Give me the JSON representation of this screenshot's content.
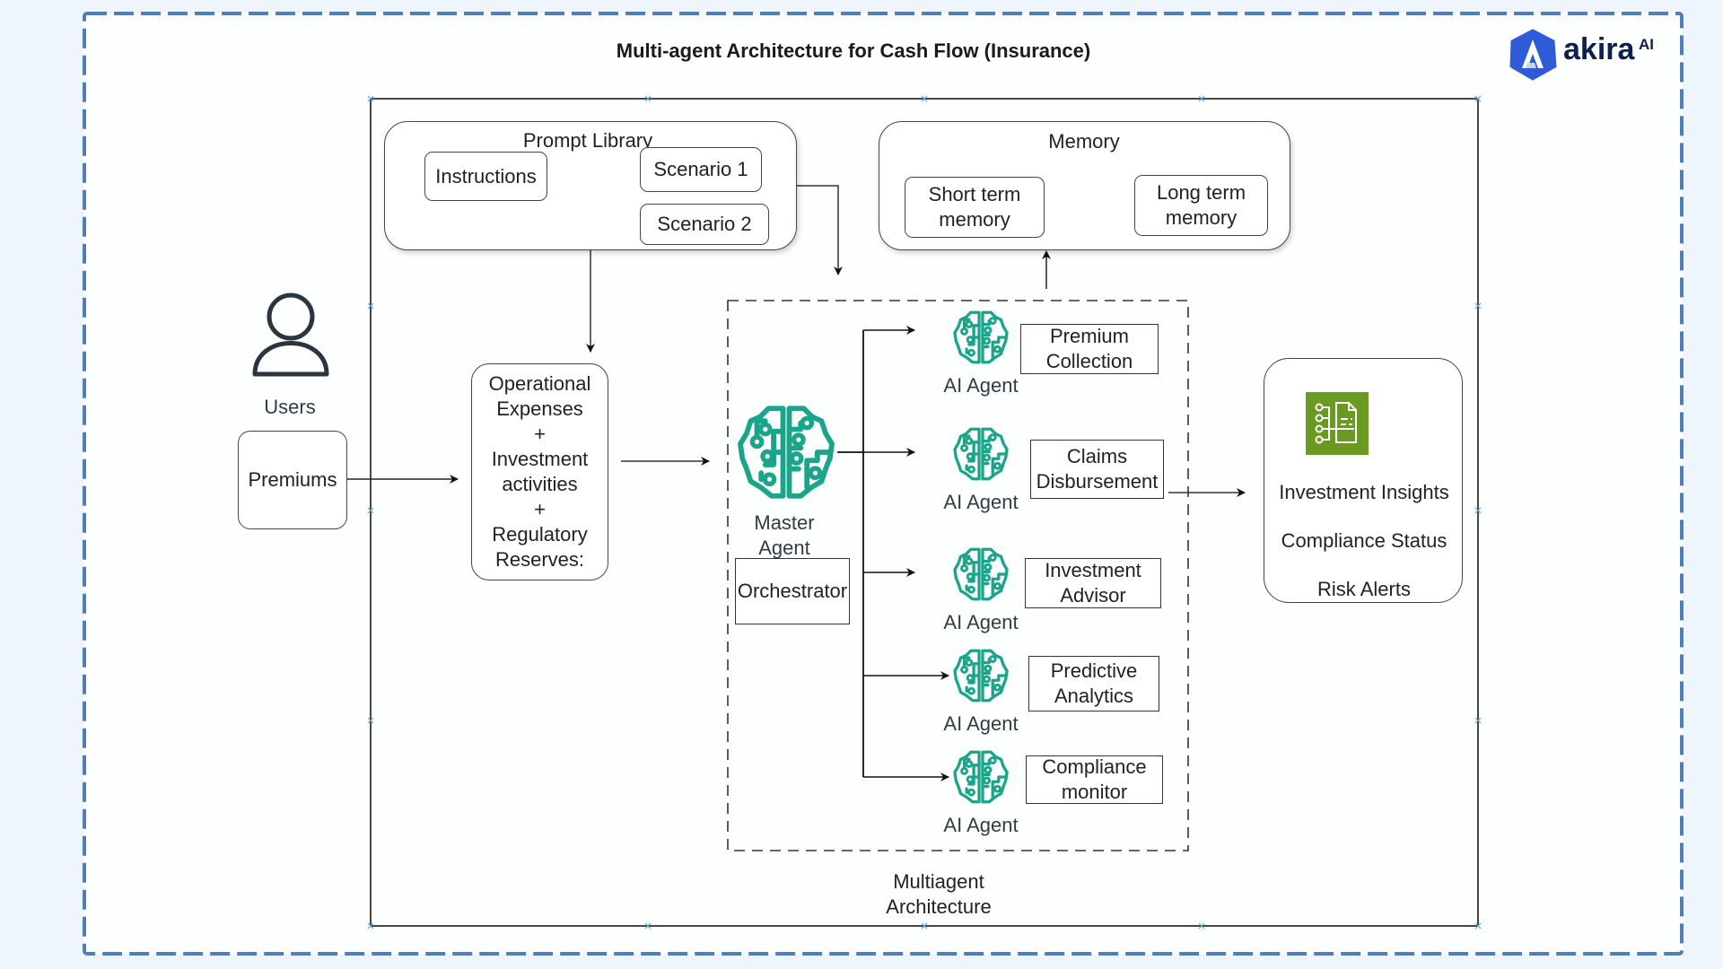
{
  "title": "Multi-agent Architecture for Cash Flow (Insurance)",
  "brand": {
    "name": "akira",
    "superscript": "AI",
    "logo_icon": "hexagon-a-logo-icon",
    "colors": {
      "logo_bg": "#2f5bd8",
      "text": "#0d1f4d"
    }
  },
  "colors": {
    "frame_dash": "#4f7db8",
    "agent_icon": "#1aa58a",
    "insights_icon_bg": "#6a9a22",
    "stroke": "#333333"
  },
  "prompt_library": {
    "label": "Prompt Library",
    "instructions": "Instructions",
    "scenarios": [
      "Scenario 1",
      "Scenario 2"
    ]
  },
  "memory": {
    "label": "Memory",
    "short_term": [
      "Short term",
      "memory"
    ],
    "long_term": [
      "Long term",
      "memory"
    ]
  },
  "users": {
    "icon": "user-icon",
    "label": "Users",
    "premiums": "Premiums"
  },
  "inputs_box": {
    "lines": [
      "Operational",
      "Expenses",
      "+",
      "Investment",
      "activities",
      "+",
      "Regulatory",
      "Reserves:"
    ]
  },
  "master_agent": {
    "icon": "brain-circuit-icon",
    "label_lines": [
      "Master",
      "Agent"
    ],
    "orchestrator": "Orchestrator"
  },
  "agents": [
    {
      "label": "AI Agent",
      "task": [
        "Premium",
        "Collection"
      ]
    },
    {
      "label": "AI Agent",
      "task": [
        "Claims",
        "Disbursement"
      ]
    },
    {
      "label": "AI Agent",
      "task": [
        "Investment",
        "Advisor"
      ]
    },
    {
      "label": "AI Agent",
      "task": [
        "Predictive",
        "Analytics"
      ]
    },
    {
      "label": "AI Agent",
      "task": [
        "Compliance",
        "monitor"
      ]
    }
  ],
  "outputs": {
    "icon": "report-insights-icon",
    "items": [
      "Investment Insights",
      "Compliance Status",
      "Risk Alerts"
    ]
  },
  "container_label": [
    "Multiagent",
    "Architecture"
  ]
}
